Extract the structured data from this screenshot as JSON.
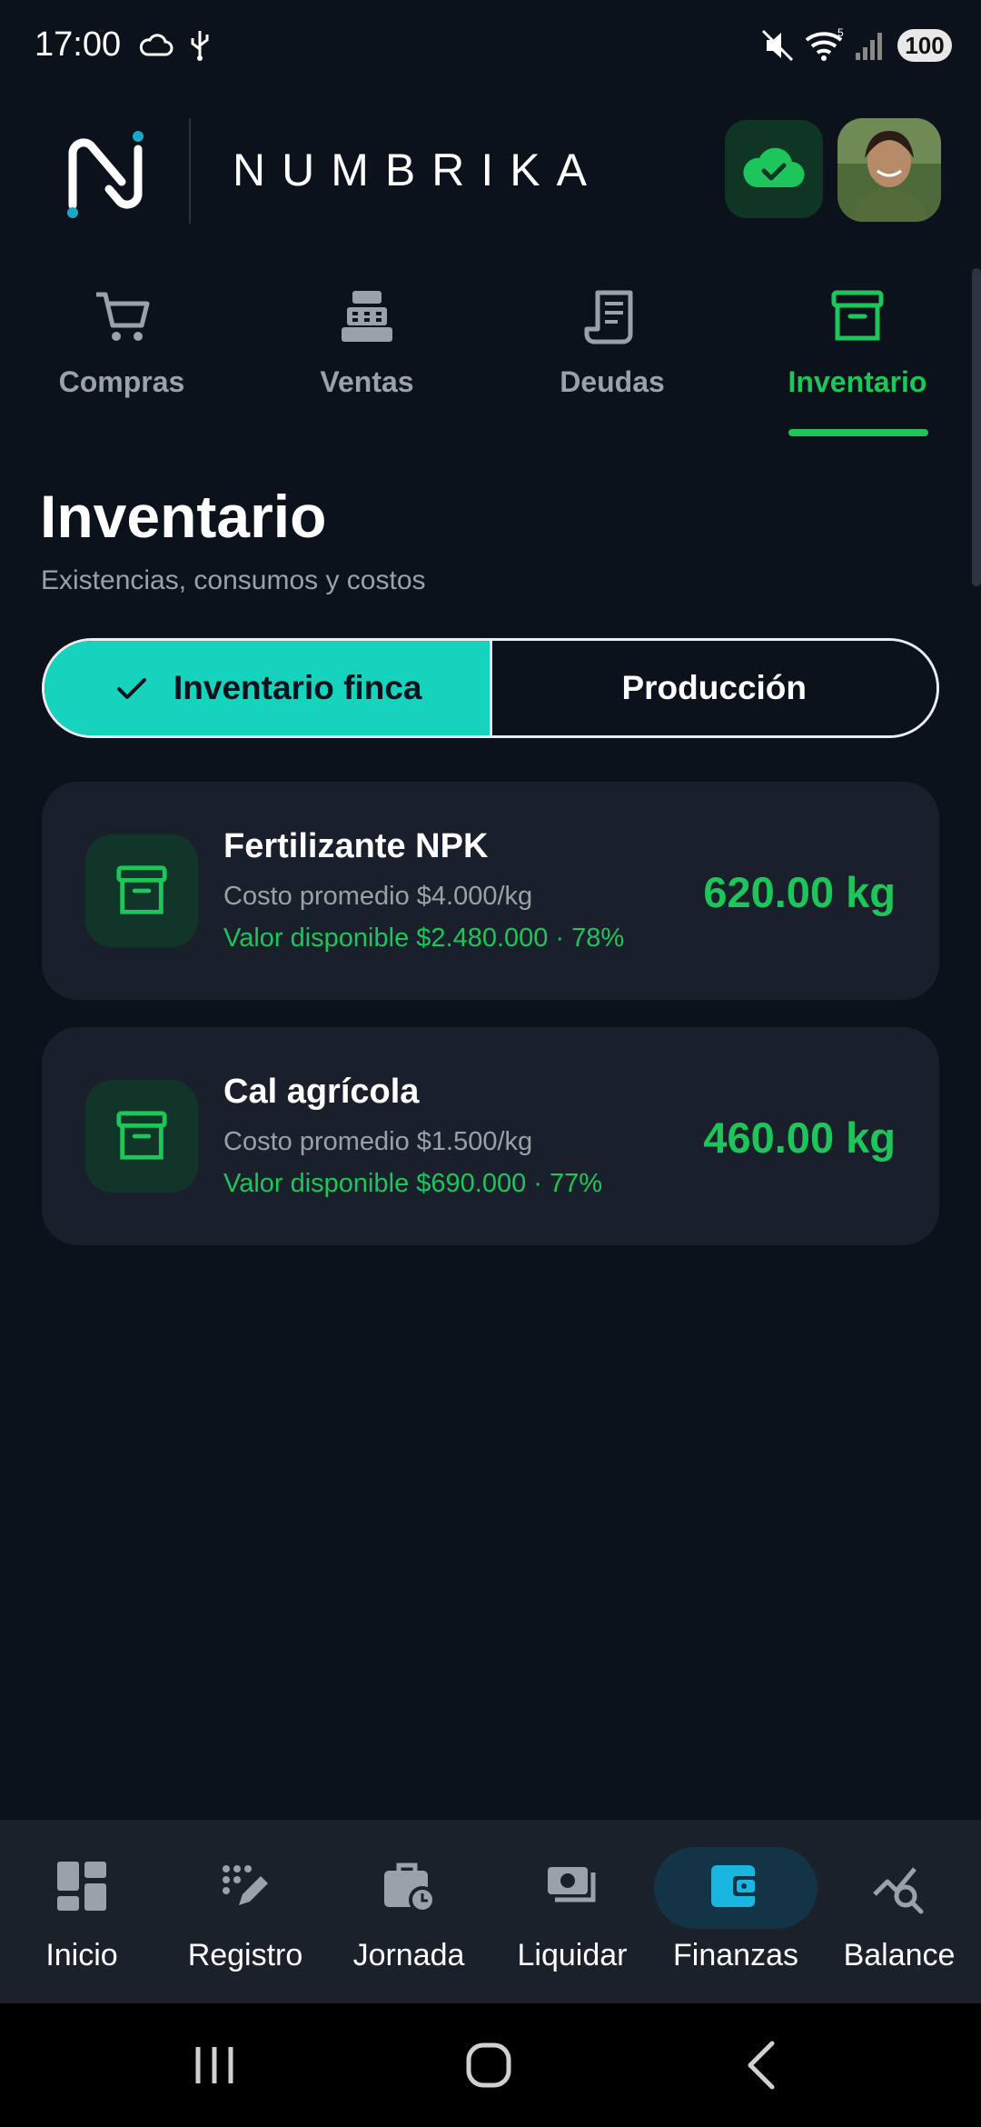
{
  "status_bar": {
    "time": "17:00",
    "battery": "100",
    "icons": [
      "cloud-outline-icon",
      "usb-icon",
      "mute-icon",
      "wifi-icon",
      "signal-icon"
    ]
  },
  "header": {
    "brand_name": "NUMBRIKA",
    "sync_icon": "cloud-check-icon",
    "avatar_alt": "user-avatar"
  },
  "tabs": [
    {
      "label": "Compras",
      "icon": "cart-icon",
      "active": false
    },
    {
      "label": "Ventas",
      "icon": "cash-register-icon",
      "active": false
    },
    {
      "label": "Deudas",
      "icon": "receipt-icon",
      "active": false
    },
    {
      "label": "Inventario",
      "icon": "archive-box-icon",
      "active": true
    }
  ],
  "page": {
    "title": "Inventario",
    "subtitle": "Existencias, consumos y costos"
  },
  "segmented": {
    "options": [
      {
        "label": "Inventario finca",
        "selected": true
      },
      {
        "label": "Producción",
        "selected": false
      }
    ]
  },
  "inventory": [
    {
      "name": "Fertilizante NPK",
      "cost": "Costo promedio $4.000/kg",
      "value": "Valor disponible $2.480.000 · 78%",
      "quantity": "620.00 kg"
    },
    {
      "name": "Cal agrícola",
      "cost": "Costo promedio $1.500/kg",
      "value": "Valor disponible $690.000 · 77%",
      "quantity": "460.00 kg"
    }
  ],
  "bottom_nav": [
    {
      "label": "Inicio",
      "icon": "dashboard-icon",
      "active": false
    },
    {
      "label": "Registro",
      "icon": "edit-dots-icon",
      "active": false
    },
    {
      "label": "Jornada",
      "icon": "briefcase-clock-icon",
      "active": false
    },
    {
      "label": "Liquidar",
      "icon": "payments-icon",
      "active": false
    },
    {
      "label": "Finanzas",
      "icon": "wallet-icon",
      "active": true
    },
    {
      "label": "Balance",
      "icon": "chart-search-icon",
      "active": false
    }
  ],
  "colors": {
    "background": "#0b121b",
    "accent_green": "#1ec55a",
    "accent_teal": "#16d3bd",
    "card": "#19202b",
    "muted_text": "#9aa1aa"
  }
}
